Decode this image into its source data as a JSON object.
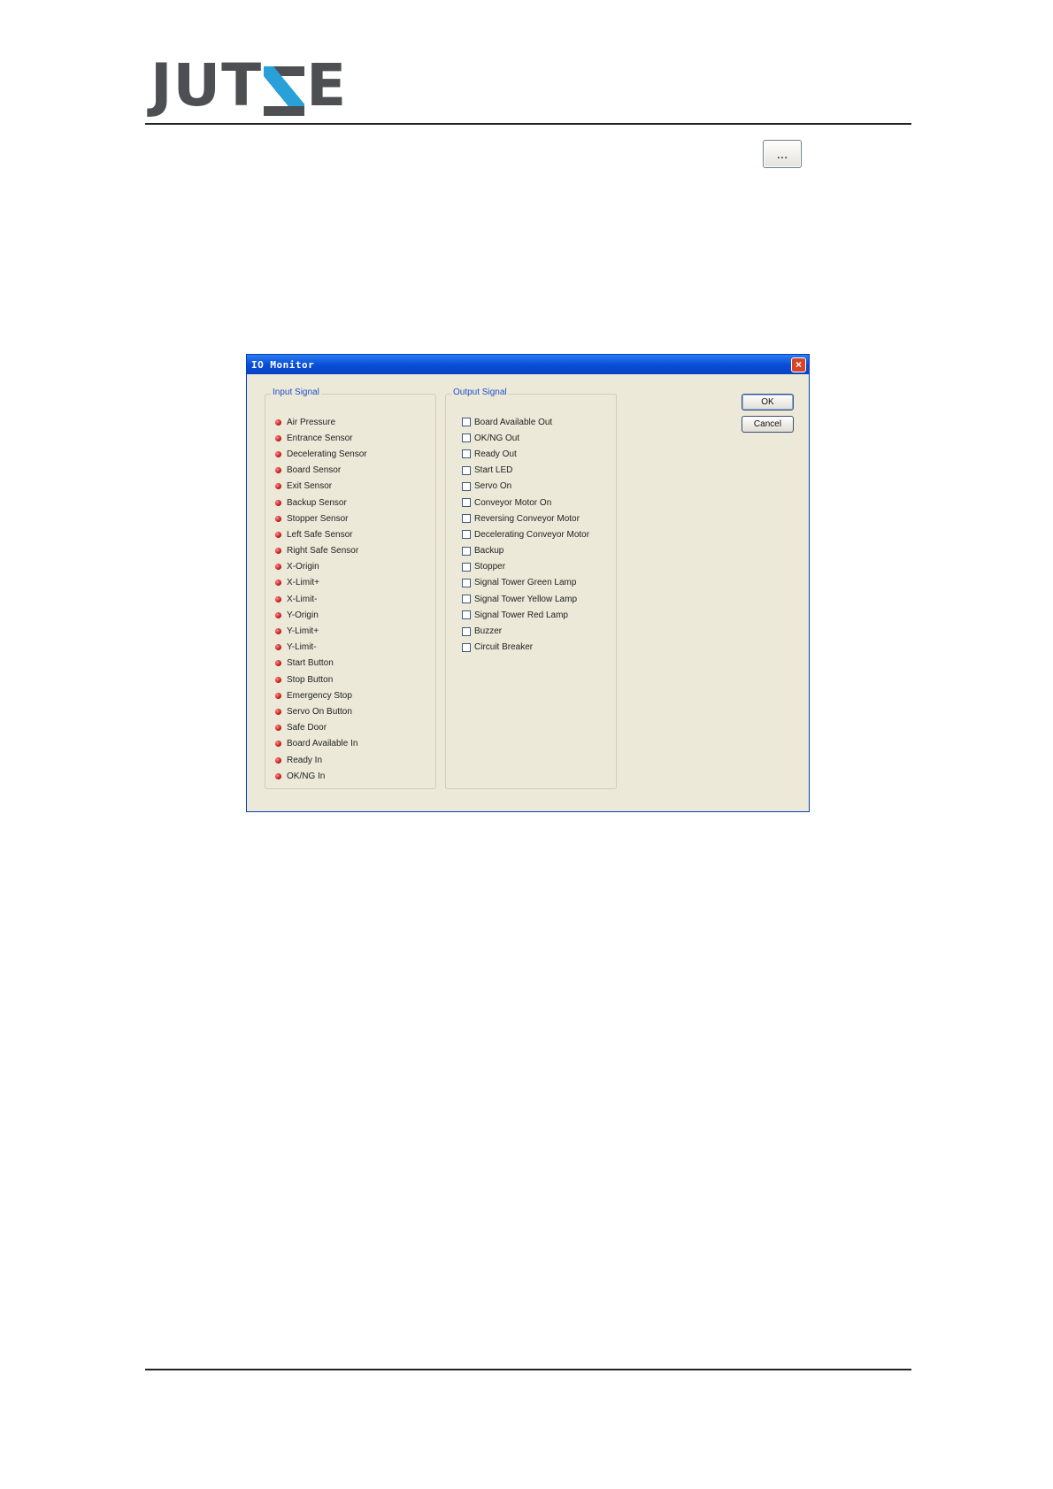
{
  "header": {
    "logo": {
      "before": "JUT",
      "after": "E",
      "brand_color": "#4d4f52",
      "accent_color": "#2aa0d8"
    },
    "ellipsis_button_label": "..."
  },
  "dialog": {
    "title": "IO Monitor",
    "close_label": "×",
    "input_group": {
      "label": "Input Signal",
      "items": [
        "Air Pressure",
        "Entrance Sensor",
        "Decelerating Sensor",
        "Board Sensor",
        "Exit Sensor",
        "Backup Sensor",
        "Stopper Sensor",
        "Left Safe Sensor",
        "Right Safe Sensor",
        "X-Origin",
        "X-Limit+",
        "X-Limit-",
        "Y-Origin",
        "Y-Limit+",
        "Y-Limit-",
        "Start Button",
        "Stop Button",
        "Emergency Stop",
        "Servo On Button",
        "Safe Door",
        "Board Available In",
        "Ready In",
        "OK/NG In"
      ]
    },
    "output_group": {
      "label": "Output Signal",
      "items": [
        "Board Available Out",
        "OK/NG Out",
        "Ready Out",
        "Start LED",
        "Servo On",
        "Conveyor Motor On",
        "Reversing Conveyor Motor",
        "Decelerating Conveyor Motor",
        "Backup",
        "Stopper",
        "Signal Tower Green Lamp",
        "Signal Tower Yellow Lamp",
        "Signal Tower Red Lamp",
        "Buzzer",
        "Circuit Breaker"
      ]
    },
    "buttons": {
      "ok": "OK",
      "cancel": "Cancel"
    },
    "led_color": "#c41a1a",
    "titlebar_color": "#0a4fd8"
  }
}
